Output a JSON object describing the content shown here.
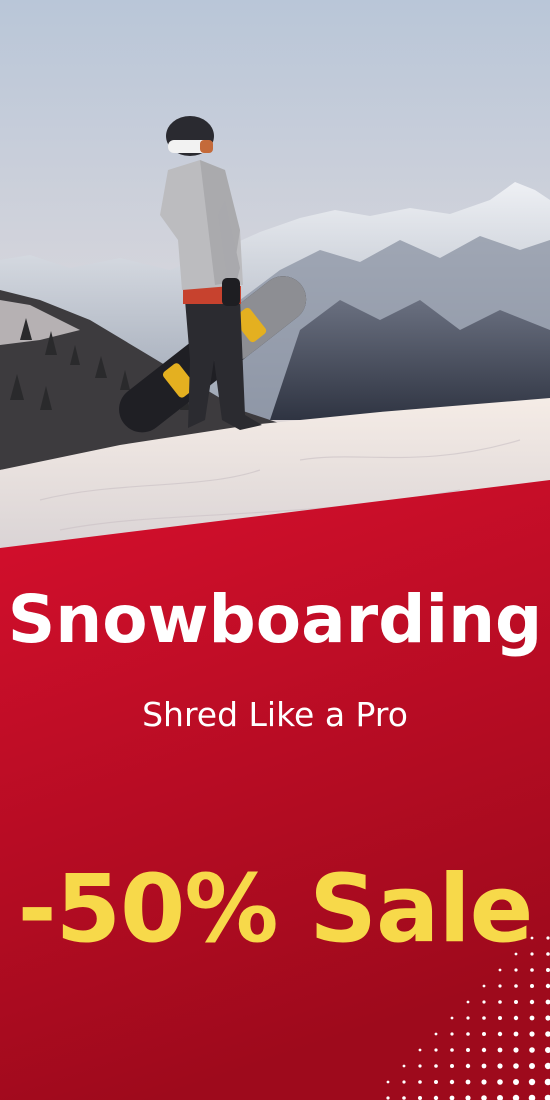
{
  "banner": {
    "headline": "Snowboarding",
    "tagline": "Shred Like a Pro",
    "sale": "-50% Sale"
  },
  "colors": {
    "panel_top": "#d60f2d",
    "panel_bottom": "#9e0a1c",
    "headline": "#ffffff",
    "sale": "#f7d94a",
    "dots": "#ffffff"
  },
  "icons": {
    "photo": "snowboarder-mountain-photo",
    "pattern": "dot-pattern-icon"
  }
}
